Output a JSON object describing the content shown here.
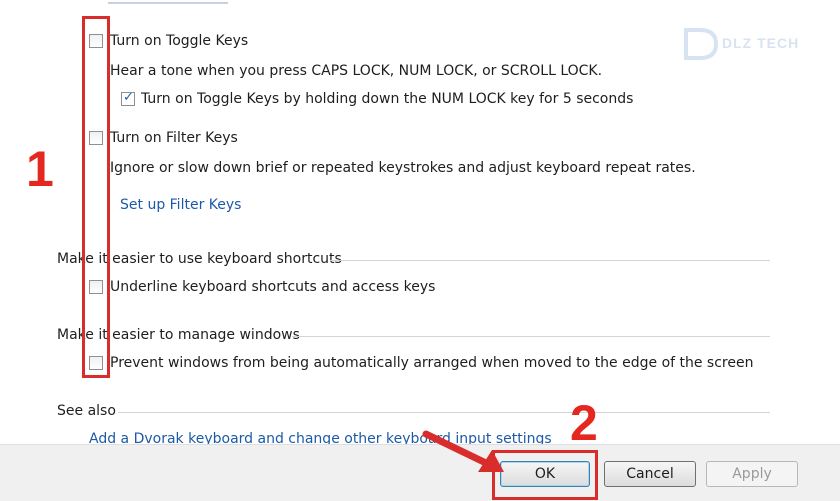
{
  "watermark": {
    "text": "DLZ TECH"
  },
  "toggle_keys": {
    "checkbox_label": "Turn on Toggle Keys",
    "checked": false,
    "description": "Hear a tone when you press CAPS LOCK, NUM LOCK, or SCROLL LOCK.",
    "sub_option": {
      "label": "Turn on Toggle Keys by holding down the NUM LOCK key for 5 seconds",
      "checked": true
    }
  },
  "filter_keys": {
    "checkbox_label": "Turn on Filter Keys",
    "checked": false,
    "description": "Ignore or slow down brief or repeated keystrokes and adjust keyboard repeat rates.",
    "setup_link": "Set up Filter Keys"
  },
  "shortcuts_section": {
    "heading": "Make it easier to use keyboard shortcuts",
    "checkbox_label": "Underline keyboard shortcuts and access keys",
    "checked": false
  },
  "windows_section": {
    "heading": "Make it easier to manage windows",
    "checkbox_label": "Prevent windows from being automatically arranged when moved to the edge of the screen",
    "checked": false
  },
  "see_also": {
    "heading": "See also",
    "link": "Add a Dvorak keyboard and change other keyboard input settings"
  },
  "buttons": {
    "ok": "OK",
    "cancel": "Cancel",
    "apply": "Apply"
  },
  "annotations": {
    "step1": "1",
    "step2": "2"
  },
  "colors": {
    "annotation": "#d92d2b",
    "link": "#1c5aa8",
    "checkmark": "#1c5fb8"
  }
}
